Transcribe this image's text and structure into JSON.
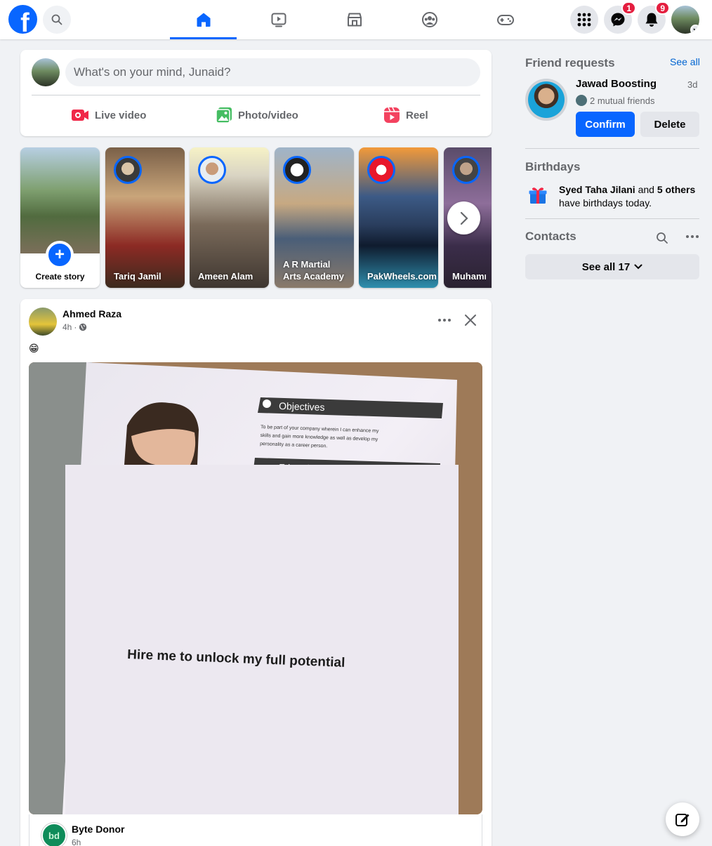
{
  "nav": {
    "logo_text": "f",
    "messenger_badge": "1",
    "notifications_badge": "9"
  },
  "composer": {
    "placeholder": "What's on your mind, Junaid?",
    "live_video": "Live video",
    "photo_video": "Photo/video",
    "reel": "Reel"
  },
  "stories": {
    "create_label": "Create story",
    "items": [
      {
        "name": "Tariq Jamil"
      },
      {
        "name": "Ameen Alam"
      },
      {
        "name": "A R Martial Arts Academy"
      },
      {
        "name": "PakWheels.com"
      },
      {
        "name": "Muhammad Imran"
      }
    ]
  },
  "post": {
    "author": "Ahmed Raza",
    "time": "4h",
    "emoji": "😁",
    "image": {
      "heading_objectives": "Objectives",
      "objectives_text": "To be part of your company wherein I can enhance my skills and gain more knowledge as well as develop my personality as a career person.",
      "heading_education": "Education",
      "caption": "Hire me to unlock my full potential"
    },
    "shared": {
      "avatar_text": "bd",
      "author": "Byte Donor",
      "time": "6h"
    }
  },
  "sidebar": {
    "friend_requests_title": "Friend requests",
    "see_all": "See all",
    "request": {
      "name": "Jawad Boosting",
      "time": "3d",
      "mutual": "2 mutual friends",
      "confirm": "Confirm",
      "delete": "Delete"
    },
    "birthdays_title": "Birthdays",
    "birthday_name": "Syed Taha Jilani",
    "birthday_and": "and",
    "birthday_others": "5 others",
    "birthday_suffix": "have birthdays today.",
    "contacts_title": "Contacts",
    "contacts_see_all": "See all 17"
  },
  "colors": {
    "brand": "#0866ff",
    "badge": "#e41e3f",
    "background": "#f0f2f5"
  }
}
